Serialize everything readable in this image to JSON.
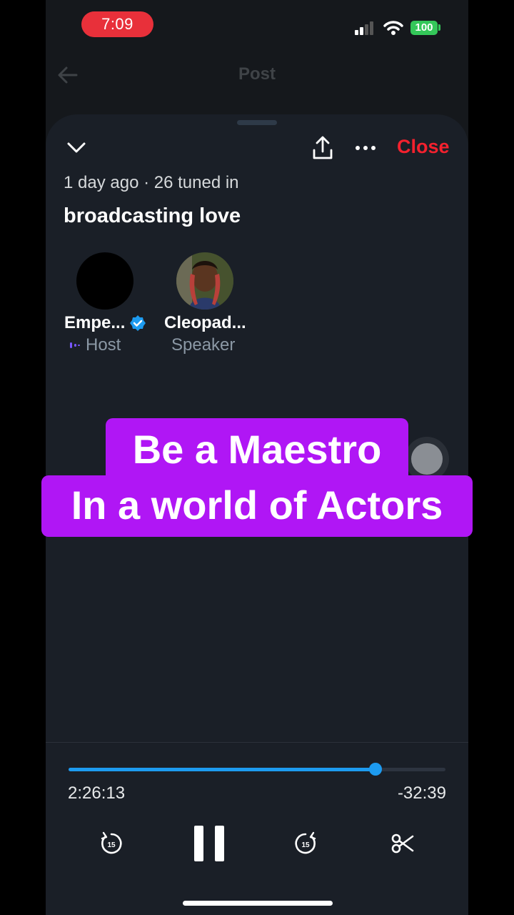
{
  "status_bar": {
    "time": "7:09",
    "battery": "100"
  },
  "header": {
    "title": "Post"
  },
  "sheet": {
    "close_label": "Close",
    "meta": "1 day ago · 26 tuned in",
    "title": "broadcasting love",
    "participants": [
      {
        "name": "Empe...",
        "role": "Host"
      },
      {
        "name": "Cleopad...",
        "role": "Speaker"
      }
    ]
  },
  "caption": {
    "line1": "Be a Maestro",
    "line2": "In a world of Actors"
  },
  "player": {
    "elapsed": "2:26:13",
    "remaining": "-32:39",
    "progress": 0.815,
    "skip_seconds": "15"
  },
  "colors": {
    "accent": "#1d9bf0",
    "close": "#f4212e",
    "caption_bg": "#b016f5",
    "time_pill": "#e8303a",
    "battery": "#34c759"
  },
  "icons": [
    "signal-icon",
    "wifi-icon",
    "back-arrow-icon",
    "chevron-down-icon",
    "share-icon",
    "more-icon",
    "verified-icon",
    "audio-wave-icon",
    "rewind-15-icon",
    "pause-icon",
    "forward-15-icon",
    "scissors-icon"
  ]
}
